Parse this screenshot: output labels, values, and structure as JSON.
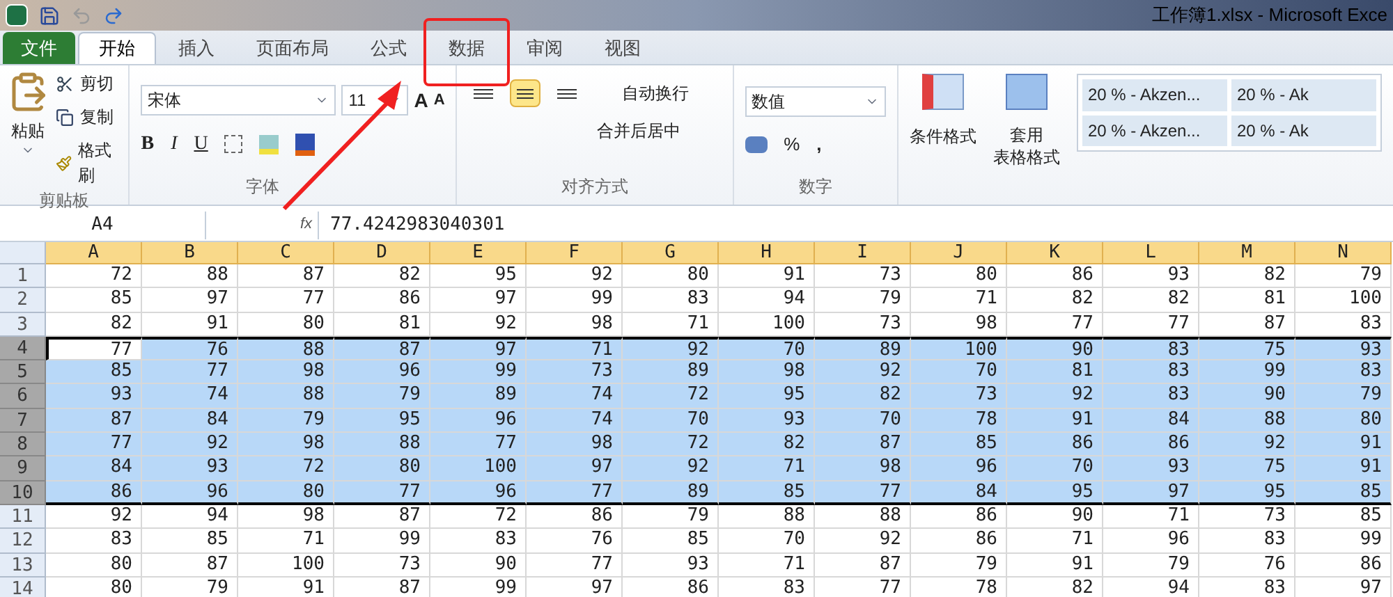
{
  "window": {
    "title": "工作簿1.xlsx  -  Microsoft Exce"
  },
  "tabs": [
    {
      "label": "文件",
      "kind": "file",
      "selected": false
    },
    {
      "label": "开始",
      "kind": "tab",
      "selected": true
    },
    {
      "label": "插入",
      "kind": "tab",
      "selected": false
    },
    {
      "label": "页面布局",
      "kind": "tab",
      "selected": false
    },
    {
      "label": "公式",
      "kind": "tab",
      "selected": false
    },
    {
      "label": "数据",
      "kind": "tab",
      "selected": false,
      "annotated": true
    },
    {
      "label": "审阅",
      "kind": "tab",
      "selected": false
    },
    {
      "label": "视图",
      "kind": "tab",
      "selected": false
    }
  ],
  "clipboard": {
    "paste": "粘贴",
    "cut": "剪切",
    "copy": "复制",
    "format_painter": "格式刷",
    "label": "剪贴板"
  },
  "font": {
    "name": "宋体",
    "size": "11",
    "label": "字体",
    "grow": "A",
    "shrink": "A",
    "bold": "B",
    "italic": "I",
    "underline": "U"
  },
  "alignment": {
    "vertical": [
      {
        "selected": false
      },
      {
        "selected": true
      },
      {
        "selected": false
      }
    ],
    "wrap": "自动换行",
    "merge": "合并后居中",
    "label": "对齐方式"
  },
  "number": {
    "format": "数值",
    "percent": "%",
    "comma": ",",
    "label": "数字"
  },
  "styles": {
    "conditional": "条件格式",
    "table_line1": "套用",
    "table_line2": "表格格式",
    "cells": [
      "20 % - Akzen...",
      "20 % - Ak",
      "20 % - Akzen...",
      "20 % - Ak"
    ]
  },
  "formula_bar": {
    "name_box": "A4",
    "fx": "fx",
    "value": "77.4242983040301"
  },
  "grid": {
    "columns": [
      {
        "label": "A",
        "selected": true
      },
      {
        "label": "B",
        "selected": true
      },
      {
        "label": "C",
        "selected": true
      },
      {
        "label": "D",
        "selected": true
      },
      {
        "label": "E",
        "selected": true
      },
      {
        "label": "F",
        "selected": true
      },
      {
        "label": "G",
        "selected": true
      },
      {
        "label": "H",
        "selected": true
      },
      {
        "label": "I",
        "selected": true
      },
      {
        "label": "J",
        "selected": true
      },
      {
        "label": "K",
        "selected": true
      },
      {
        "label": "L",
        "selected": true
      },
      {
        "label": "M",
        "selected": true
      },
      {
        "label": "N",
        "selected": true
      }
    ],
    "rows": [
      {
        "number": "1",
        "selected": false,
        "cells": [
          "72",
          "88",
          "87",
          "82",
          "95",
          "92",
          "80",
          "91",
          "73",
          "80",
          "86",
          "93",
          "82",
          "79"
        ]
      },
      {
        "number": "2",
        "selected": false,
        "cells": [
          "85",
          "97",
          "77",
          "86",
          "97",
          "99",
          "83",
          "94",
          "79",
          "71",
          "82",
          "82",
          "81",
          "100"
        ]
      },
      {
        "number": "3",
        "selected": false,
        "cells": [
          "82",
          "91",
          "80",
          "81",
          "92",
          "98",
          "71",
          "100",
          "73",
          "98",
          "77",
          "77",
          "87",
          "83"
        ]
      },
      {
        "number": "4",
        "selected": true,
        "active": true,
        "cells": [
          "77",
          "76",
          "88",
          "87",
          "97",
          "71",
          "92",
          "70",
          "89",
          "100",
          "90",
          "83",
          "75",
          "93"
        ]
      },
      {
        "number": "5",
        "selected": true,
        "cells": [
          "85",
          "77",
          "98",
          "96",
          "99",
          "73",
          "89",
          "98",
          "92",
          "70",
          "81",
          "83",
          "99",
          "83"
        ]
      },
      {
        "number": "6",
        "selected": true,
        "cells": [
          "93",
          "74",
          "88",
          "79",
          "89",
          "74",
          "72",
          "95",
          "82",
          "73",
          "92",
          "83",
          "90",
          "79"
        ]
      },
      {
        "number": "7",
        "selected": true,
        "cells": [
          "87",
          "84",
          "79",
          "95",
          "96",
          "74",
          "70",
          "93",
          "70",
          "78",
          "91",
          "84",
          "88",
          "80"
        ]
      },
      {
        "number": "8",
        "selected": true,
        "cells": [
          "77",
          "92",
          "98",
          "88",
          "77",
          "98",
          "72",
          "82",
          "87",
          "85",
          "86",
          "86",
          "92",
          "91"
        ]
      },
      {
        "number": "9",
        "selected": true,
        "cells": [
          "84",
          "93",
          "72",
          "80",
          "100",
          "97",
          "92",
          "71",
          "98",
          "96",
          "70",
          "93",
          "75",
          "91"
        ]
      },
      {
        "number": "10",
        "selected": true,
        "cells": [
          "86",
          "96",
          "80",
          "77",
          "96",
          "77",
          "89",
          "85",
          "77",
          "84",
          "95",
          "97",
          "95",
          "85"
        ]
      },
      {
        "number": "11",
        "selected": false,
        "cells": [
          "92",
          "94",
          "98",
          "87",
          "72",
          "86",
          "79",
          "88",
          "88",
          "86",
          "90",
          "71",
          "73",
          "85"
        ]
      },
      {
        "number": "12",
        "selected": false,
        "cells": [
          "83",
          "85",
          "71",
          "99",
          "83",
          "76",
          "85",
          "70",
          "92",
          "86",
          "71",
          "96",
          "83",
          "99"
        ]
      },
      {
        "number": "13",
        "selected": false,
        "cells": [
          "80",
          "87",
          "100",
          "73",
          "90",
          "77",
          "93",
          "71",
          "87",
          "79",
          "91",
          "79",
          "76",
          "86"
        ]
      },
      {
        "number": "14",
        "selected": false,
        "cells": [
          "80",
          "79",
          "91",
          "87",
          "99",
          "97",
          "86",
          "83",
          "77",
          "78",
          "82",
          "94",
          "83",
          "97"
        ]
      }
    ]
  }
}
